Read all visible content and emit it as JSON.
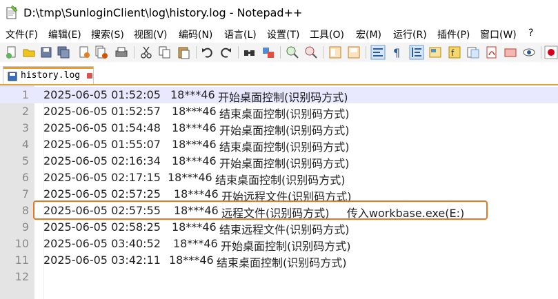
{
  "window": {
    "title": "D:\\tmp\\SunloginClient\\log\\history.log - Notepad++"
  },
  "menu": [
    "文件(F)",
    "编辑(E)",
    "搜索(S)",
    "视图(V)",
    "编码(N)",
    "语言(L)",
    "设置(T)",
    "工具(O)",
    "宏(M)",
    "运行(R)",
    "插件(P)",
    "窗口(W)",
    "?"
  ],
  "toolbar_icons": [
    "new-file-icon",
    "open-file-icon",
    "save-icon",
    "save-all-icon",
    "close-icon",
    "close-all-icon",
    "print-icon",
    "cut-icon",
    "copy-icon",
    "paste-icon",
    "undo-icon",
    "redo-icon",
    "find-icon",
    "replace-icon",
    "zoom-in-icon",
    "zoom-out-icon",
    "sync-v-icon",
    "sync-h-icon",
    "wrap-icon",
    "show-all-icon",
    "indent-guide-icon",
    "doc-map-icon",
    "func-list-icon",
    "folder-workspace-icon",
    "monitor-icon",
    "pdf-icon",
    "macro-icon",
    "eye-icon",
    "record-icon"
  ],
  "tab": {
    "label": "history.log"
  },
  "lines": [
    {
      "num": "1",
      "datetime": "2025-06-05 01:52:05",
      "user": "18***46",
      "message": "开始桌面控制(识别码方式)"
    },
    {
      "num": "2",
      "datetime": "2025-06-05 01:52:57",
      "user": "18***46",
      "message": "结束桌面控制(识别码方式)"
    },
    {
      "num": "3",
      "datetime": "2025-06-05 01:54:48",
      "user": "18***46",
      "message": "开始桌面控制(识别码方式)"
    },
    {
      "num": "4",
      "datetime": "2025-06-05 01:55:07",
      "user": "18***46",
      "message": "结束桌面控制(识别码方式)"
    },
    {
      "num": "5",
      "datetime": "2025-06-05 02:16:34",
      "user": "18***46",
      "message": "开始桌面控制(识别码方式)"
    },
    {
      "num": "6",
      "datetime": "2025-06-05 02:17:15",
      "user": "18***46",
      "message": "结束桌面控制(识别码方式)"
    },
    {
      "num": "7",
      "datetime": "2025-06-05 02:57:25",
      "user": "18***46",
      "message": "开始远程文件(识别码方式)"
    },
    {
      "num": "8",
      "datetime": "2025-06-05 02:57:55",
      "user": "18***46",
      "message": "远程文件(识别码方式)     传入workbase.exe(E:)"
    },
    {
      "num": "9",
      "datetime": "2025-06-05 02:58:25",
      "user": "18***46",
      "message": "结束远程文件(识别码方式)"
    },
    {
      "num": "10",
      "datetime": "2025-06-05 03:40:52",
      "user": "18***46",
      "message": "开始桌面控制(识别码方式)"
    },
    {
      "num": "11",
      "datetime": "2025-06-05 03:42:11",
      "user": "18***46",
      "message": "结束桌面控制(识别码方式)"
    },
    {
      "num": "12",
      "datetime": "",
      "user": "",
      "message": ""
    }
  ],
  "colors": {
    "highlight": "#e87722",
    "current_line": "#e8e8ff",
    "gutter": "#e4e4e4"
  }
}
